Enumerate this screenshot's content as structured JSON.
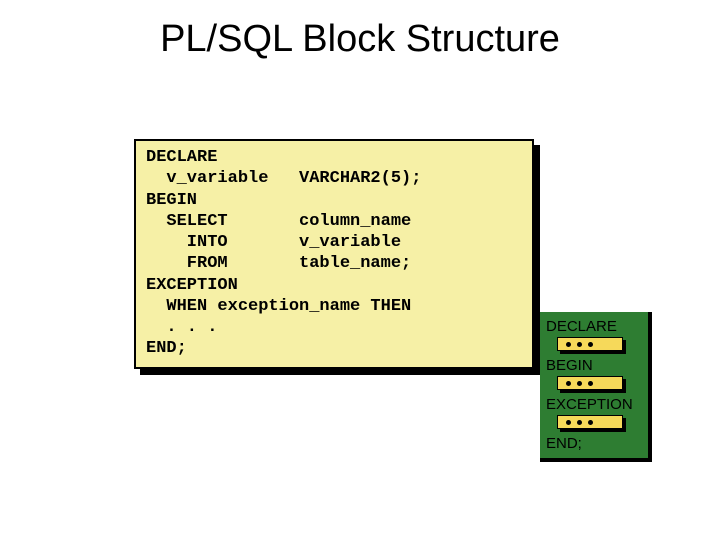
{
  "title": "PL/SQL Block Structure",
  "code": {
    "l0": "DECLARE",
    "l1": "  v_variable   VARCHAR2(5);",
    "l2": "BEGIN",
    "l3": "  SELECT       column_name",
    "l4": "    INTO       v_variable",
    "l5": "    FROM       table_name;",
    "l6": "EXCEPTION",
    "l7": "  WHEN exception_name THEN",
    "l8": "  . . .",
    "l9": "END;"
  },
  "legend": {
    "declare": "DECLARE",
    "begin": "BEGIN",
    "exception": "EXCEPTION",
    "end": "END;"
  }
}
